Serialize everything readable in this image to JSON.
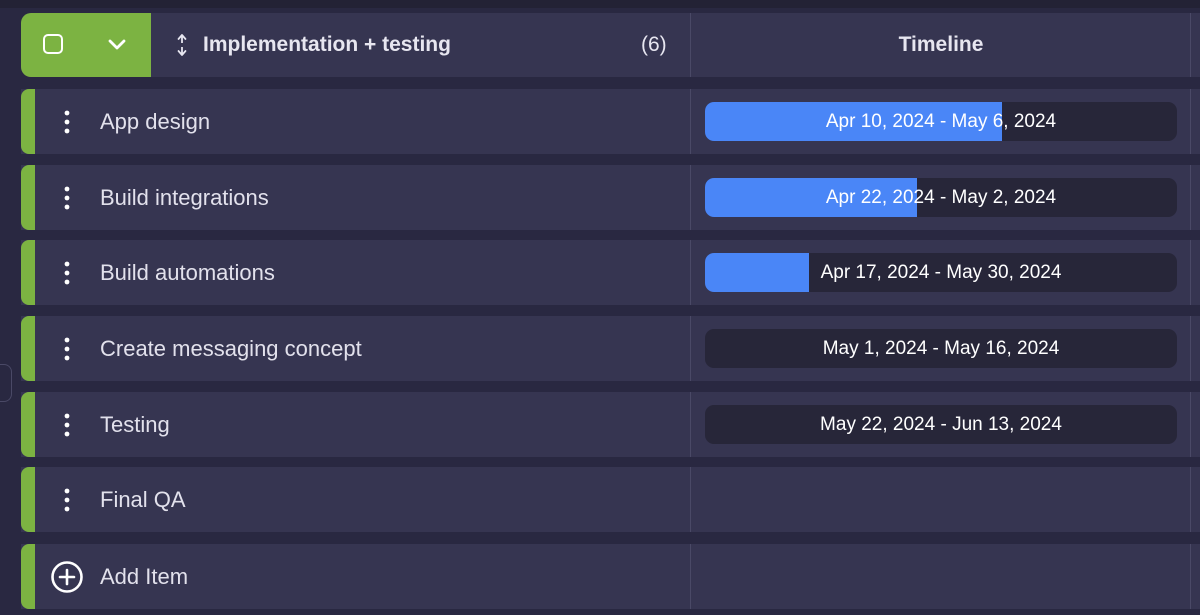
{
  "group": {
    "title": "Implementation + testing",
    "count": "(6)",
    "timeline_header": "Timeline",
    "color": "#7cb342"
  },
  "items": [
    {
      "name": "App design",
      "timeline": "Apr 10, 2024 - May 6, 2024",
      "progress": 0.63
    },
    {
      "name": "Build integrations",
      "timeline": "Apr 22, 2024 - May 2, 2024",
      "progress": 0.45
    },
    {
      "name": "Build automations",
      "timeline": "Apr 17, 2024 - May 30, 2024",
      "progress": 0.22
    },
    {
      "name": "Create messaging concept",
      "timeline": "May 1, 2024 - May 16, 2024",
      "progress": 0
    },
    {
      "name": "Testing",
      "timeline": "May 22, 2024 - Jun 13, 2024",
      "progress": 0
    },
    {
      "name": "Final QA",
      "timeline": "",
      "progress": null
    }
  ],
  "add_item": {
    "label": "Add Item"
  },
  "colors": {
    "accent": "#7cb342",
    "timeline_fill": "#4a86f7",
    "row_bg": "#363551",
    "page_bg": "#292841"
  },
  "icons": {
    "checkbox": "checkbox-icon",
    "collapse": "chevron-down-icon",
    "sort": "sort-icon",
    "row_menu": "more-vertical-icon",
    "add": "plus-circle-icon"
  }
}
